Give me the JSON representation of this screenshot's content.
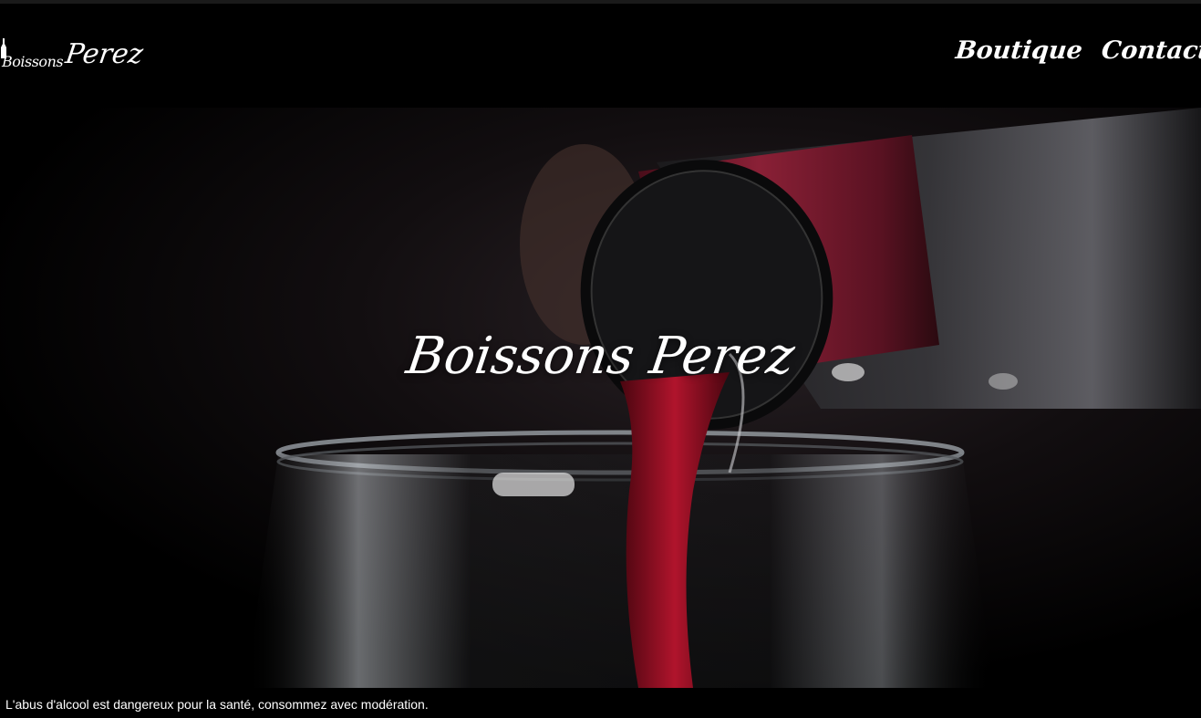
{
  "header": {
    "logo_small": "Boissons",
    "logo_big": "Perez",
    "nav": [
      {
        "label": "Boutique"
      },
      {
        "label": "Contact"
      }
    ]
  },
  "hero": {
    "title": "Boissons Perez",
    "image": "wine-pouring-into-glass"
  },
  "footer": {
    "warning": "L'abus d'alcool est dangereux pour la santé, consommez avec modération."
  },
  "colors": {
    "background": "#000000",
    "text": "#ffffff",
    "wine": "#8b1024",
    "foil": "#7a1a2e"
  }
}
